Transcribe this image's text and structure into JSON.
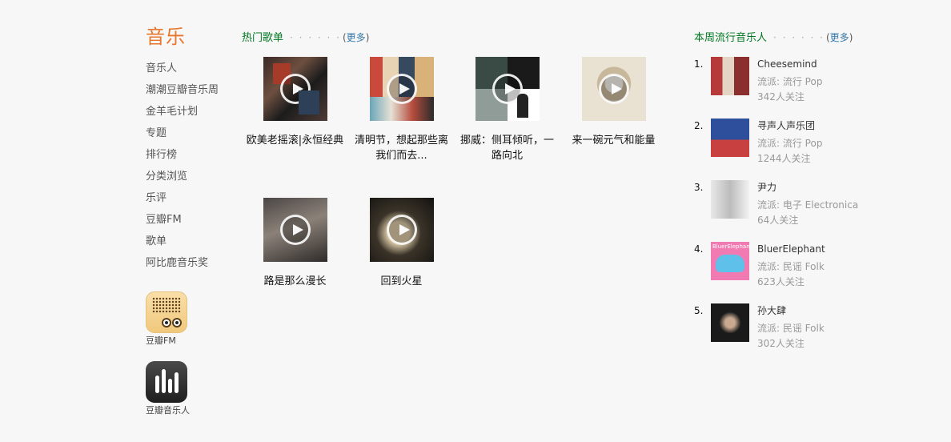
{
  "left": {
    "title": "音乐",
    "nav": [
      "音乐人",
      "潮潮豆瓣音乐周",
      "金羊毛计划",
      "专题",
      "排行榜",
      "分类浏览",
      "乐评",
      "豆瓣FM",
      "歌单",
      "阿比鹿音乐奖"
    ],
    "apps": [
      {
        "label": "豆瓣FM",
        "icon": "radio-app-icon"
      },
      {
        "label": "豆瓣音乐人",
        "icon": "equalizer-app-icon"
      }
    ]
  },
  "playlists": {
    "title": "热门歌单",
    "dots": "· · · · · ·",
    "more_open": "(",
    "more": "更多",
    "more_close": ")",
    "items": [
      {
        "name": "欧美老摇滚|永恒经典"
      },
      {
        "name": "清明节，想起那些离我们而去..."
      },
      {
        "name": "挪威：侧耳倾听，一路向北"
      },
      {
        "name": "来一碗元气和能量"
      },
      {
        "name": "路是那么漫长"
      },
      {
        "name": "回到火星"
      }
    ]
  },
  "artists": {
    "title": "本周流行音乐人",
    "dots": "· · · · · ·",
    "more_open": "(",
    "more": "更多",
    "more_close": ")",
    "items": [
      {
        "rank": "1.",
        "name": "Cheesemind",
        "genre": "流派: 流行 Pop",
        "fans": "342人关注"
      },
      {
        "rank": "2.",
        "name": "寻声人声乐团",
        "genre": "流派: 流行 Pop",
        "fans": "1244人关注"
      },
      {
        "rank": "3.",
        "name": "尹力",
        "genre": "流派: 电子 Electronica",
        "fans": "64人关注"
      },
      {
        "rank": "4.",
        "name": "BluerElephant",
        "genre": "流派: 民谣 Folk",
        "fans": "623人关注",
        "photo_text": "BluerElephant"
      },
      {
        "rank": "5.",
        "name": "孙大肆",
        "genre": "流派: 民谣 Folk",
        "fans": "302人关注"
      }
    ]
  },
  "colors": {
    "accent": "#e8762d",
    "section_title": "#007722",
    "link": "#3377aa",
    "muted": "#999999"
  }
}
